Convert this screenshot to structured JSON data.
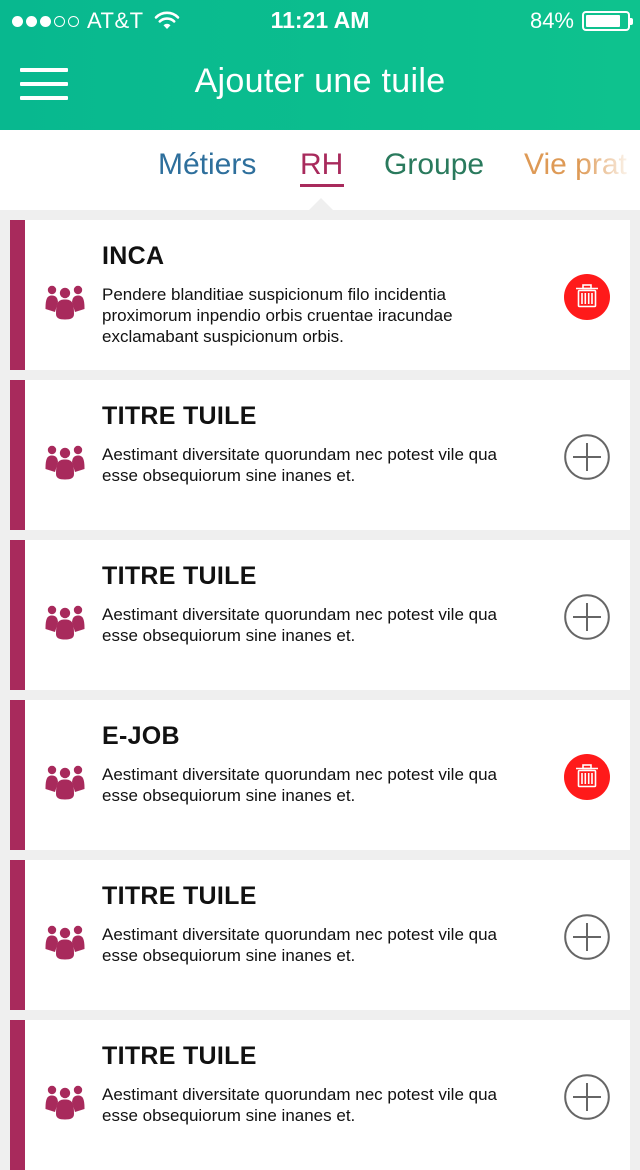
{
  "status_bar": {
    "carrier": "AT&T",
    "time": "11:21 AM",
    "battery": "84%",
    "battery_level": 0.84,
    "signal_bars_filled": 3,
    "signal_bars_total": 5
  },
  "header": {
    "title": "Ajouter une tuile",
    "menu_icon": "hamburger-menu-icon"
  },
  "tabs": [
    {
      "label": "Métiers",
      "color": "#2e6f9c",
      "active": false
    },
    {
      "label": "RH",
      "color": "#a82a5c",
      "active": true
    },
    {
      "label": "Groupe",
      "color": "#2a7a5d",
      "active": false
    },
    {
      "label": "Vie prat",
      "color": "#de9a56",
      "active": false
    }
  ],
  "colors": {
    "header": "#0ab98f",
    "accent": "#a82a5c",
    "delete": "#ff1a1a"
  },
  "tiles": [
    {
      "title": "INCA",
      "description": "Pendere blanditiae suspicionum filo incidentia proximorum inpendio orbis cruentae iracundae exclamabant suspicionum orbis.",
      "icon": "people-group-icon",
      "action": "delete",
      "action_icon": "trash-icon"
    },
    {
      "title": "TITRE TUILE",
      "description": "Aestimant diversitate quorundam nec potest vile qua esse obsequiorum sine inanes et.",
      "icon": "people-group-icon",
      "action": "add",
      "action_icon": "plus-circle-icon"
    },
    {
      "title": "TITRE TUILE",
      "description": "Aestimant diversitate quorundam nec potest vile qua esse obsequiorum sine inanes et.",
      "icon": "people-group-icon",
      "action": "add",
      "action_icon": "plus-circle-icon"
    },
    {
      "title": "E-JOB",
      "description": "Aestimant diversitate quorundam nec potest vile qua esse obsequiorum sine inanes et.",
      "icon": "people-group-icon",
      "action": "delete",
      "action_icon": "trash-icon"
    },
    {
      "title": "TITRE TUILE",
      "description": "Aestimant diversitate quorundam nec potest vile qua esse obsequiorum sine inanes et.",
      "icon": "people-group-icon",
      "action": "add",
      "action_icon": "plus-circle-icon"
    },
    {
      "title": "TITRE TUILE",
      "description": "Aestimant diversitate quorundam nec potest vile qua esse obsequiorum sine inanes et.",
      "icon": "people-group-icon",
      "action": "add",
      "action_icon": "plus-circle-icon"
    }
  ]
}
